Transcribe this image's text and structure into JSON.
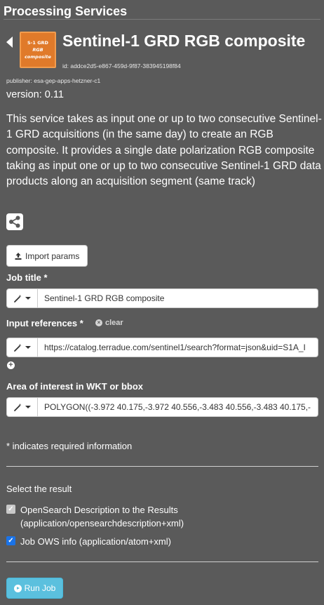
{
  "panel": {
    "title": "Processing Services"
  },
  "service": {
    "logo_line1": "S-1 GRD",
    "logo_line2": "RGB",
    "logo_line3": "composite",
    "title": "Sentinel-1 GRD RGB composite",
    "id": "id: addce2d5-e867-459d-9f87-383945198f84",
    "publisher": "publisher: esa-gep-apps-hetzner-c1",
    "version": "version: 0.11",
    "description": "This service takes as input one or up to two consecutive Sentinel-1 GRD acquisitions (in the same day) to create an RGB composite. It provides a single date polarization RGB composite taking as input one or up to two consecutive Sentinel-1 GRD data products along an acquisition segment (same track)"
  },
  "icons": {
    "back": "chevron-left-icon",
    "share": "share-icon",
    "import": "upload-icon",
    "wand": "magic-wand-icon",
    "clear": "times-circle-icon",
    "add": "plus-circle-icon",
    "run": "play-circle-icon"
  },
  "form": {
    "import_label": "Import params",
    "job_title": {
      "label": "Job title *",
      "value": "Sentinel-1 GRD RGB composite"
    },
    "input_references": {
      "label": "Input references *",
      "clear_label": "clear",
      "value": "https://catalog.terradue.com/sentinel1/search?format=json&uid=S1A_I"
    },
    "aoi": {
      "label": "Area of interest in WKT or bbox",
      "value": "POLYGON((-3.972 40.175,-3.972 40.556,-3.483 40.556,-3.483 40.175,-"
    },
    "required_note": "* indicates required information",
    "result_label": "Select the result",
    "results": [
      {
        "line1": "OpenSearch Description to the Results",
        "line2": "(application/opensearchdescription+xml)",
        "checked": true,
        "disabled": true
      },
      {
        "line1": "Job OWS info (application/atom+xml)",
        "checked": true,
        "disabled": false
      }
    ],
    "run_label": "Run Job"
  },
  "colors": {
    "background": "#5a5a5a",
    "logo": "#e07a2a",
    "run_button": "#5bc0de",
    "checkbox": "#1a73e8"
  }
}
